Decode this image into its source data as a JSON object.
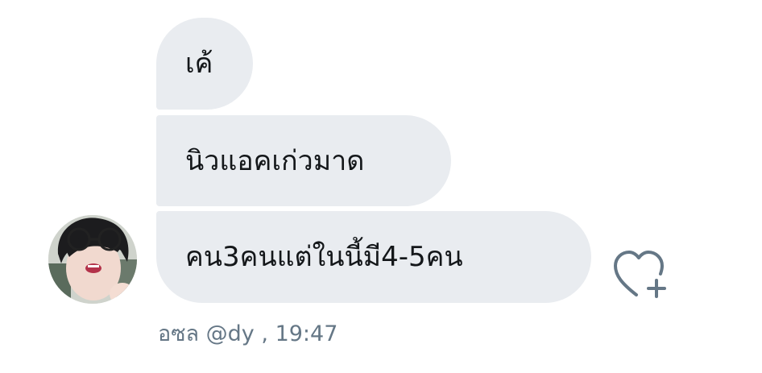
{
  "messages": [
    {
      "text": "เค้"
    },
    {
      "text": "นิวแอคเก่วมาด"
    },
    {
      "text": "คน3คนแต่ในนี้มี4-5คน"
    }
  ],
  "sender": {
    "name": "อซล @dy",
    "separator": " ,",
    "time": "19:47"
  },
  "icons": {
    "like": "heart-plus-icon",
    "avatar": "user-avatar"
  },
  "colors": {
    "bubble": "#e9ecf0",
    "text": "#14171a",
    "meta": "#657786",
    "icon": "#657786"
  }
}
